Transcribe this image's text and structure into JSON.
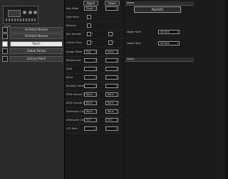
{
  "nav": {
    "items": [
      {
        "label": "All Patch Names",
        "active": false
      },
      {
        "label": "All Patch Names",
        "active": false
      },
      {
        "label": "Patch",
        "active": true
      },
      {
        "label": "Global Param",
        "active": false
      },
      {
        "label": "Library Patch",
        "active": false
      }
    ]
  },
  "device": {
    "label": "SQ-80"
  },
  "columns": {
    "upper": "Upper",
    "lower": "Lower"
  },
  "params": [
    {
      "label": "Key Mode",
      "upper": "Single",
      "lower": ""
    },
    {
      "label": "Split Point",
      "upper": "",
      "lower": ""
    },
    {
      "label": "Balance",
      "upper": "",
      "lower": ""
    },
    {
      "label": "Key Number",
      "upper": "",
      "lower": ""
    },
    {
      "label": "Coarse Tune",
      "upper": "",
      "lower": ""
    },
    {
      "label": "Assign Mode",
      "upper": "Poly",
      "lower": "Mono"
    },
    {
      "label": "Portamento",
      "upper": "",
      "lower": ""
    },
    {
      "label": "Hold",
      "upper": "",
      "lower": ""
    },
    {
      "label": "Bend",
      "upper": "",
      "lower": ""
    },
    {
      "label": "Random Variation",
      "upper": "",
      "lower": ""
    },
    {
      "label": "MOD Control 1",
      "upper": "Norm",
      "lower": "Norm"
    },
    {
      "label": "MOD Control 2",
      "upper": "Norm",
      "lower": "Norm"
    },
    {
      "label": "Aftertouch Curve",
      "upper": "Norm",
      "lower": "Norm"
    },
    {
      "label": "Aftertouch Control",
      "upper": "VCO",
      "lower": "VCO"
    },
    {
      "label": "LFO Rate",
      "upper": "",
      "lower": ""
    }
  ],
  "name_section": {
    "header": "Name",
    "value": "Patch03"
  },
  "fields": [
    {
      "label": "Upper Tone",
      "value": "Int Tone"
    },
    {
      "label": "Lower Tone",
      "value": "Int Tone"
    }
  ],
  "tones_section": {
    "header": "Tones"
  }
}
